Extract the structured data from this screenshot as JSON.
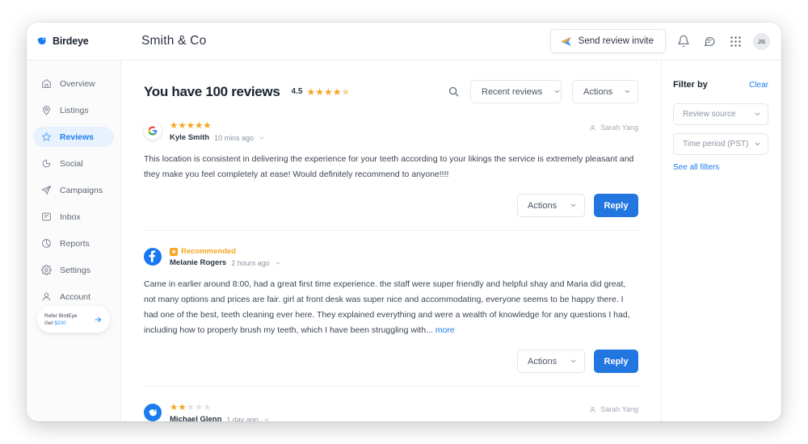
{
  "brand": {
    "name": "Birdeye",
    "logo_icon": "birdeye-logo-icon"
  },
  "header": {
    "business_title": "Smith & Co",
    "invite_button": "Send review invite",
    "invite_icon": "paper-plane-icon",
    "notifications_icon": "bell-icon",
    "messages_icon": "chat-bubble-icon",
    "apps_icon": "grid-apps-icon",
    "avatar_initials": "JS"
  },
  "sidebar": {
    "items": [
      {
        "label": "Overview",
        "icon": "home-icon",
        "active": false
      },
      {
        "label": "Listings",
        "icon": "location-pin-icon",
        "active": false
      },
      {
        "label": "Reviews",
        "icon": "star-icon",
        "active": true
      },
      {
        "label": "Social",
        "icon": "social-icon",
        "active": false
      },
      {
        "label": "Campaigns",
        "icon": "paper-plane-icon",
        "active": false
      },
      {
        "label": "Inbox",
        "icon": "inbox-message-icon",
        "active": false
      },
      {
        "label": "Reports",
        "icon": "pie-chart-icon",
        "active": false
      },
      {
        "label": "Settings",
        "icon": "gear-icon",
        "active": false
      },
      {
        "label": "Account",
        "icon": "person-icon",
        "active": false
      }
    ],
    "refer_card": {
      "line1": "Refer BirdEye",
      "line2_prefix": "Get ",
      "line2_amount": "$200",
      "arrow_icon": "arrow-right-icon"
    }
  },
  "main": {
    "page_title": "You have 100 reviews",
    "rating_value": "4.5",
    "rating_stars_filled": 4,
    "rating_stars_total": 5,
    "search_icon": "search-icon",
    "sort_select": "Recent reviews",
    "actions_select": "Actions",
    "reviews": [
      {
        "source": "google",
        "source_icon": "google-icon",
        "stars": 5,
        "recommended": null,
        "author": "Kyle Smith",
        "time": "10 mins ago",
        "assignee": "Sarah Yang",
        "assignee_icon": "person-icon",
        "text": "This location is consistent in delivering the experience for your teeth according to your likings the service is extremely pleasant and they make you feel completely at ease! Would definitely recommend to anyone!!!!",
        "more_label": null,
        "actions_label": "Actions",
        "reply_label": "Reply"
      },
      {
        "source": "facebook",
        "source_icon": "facebook-icon",
        "stars": 0,
        "recommended": "Recommended",
        "author": "Melanie Rogers",
        "time": "2 hours ago",
        "assignee": null,
        "assignee_icon": null,
        "text": "Came in earlier around 8:00, had a great first time experience. the staff were super friendly and helpful shay and Maria did great, not many options and prices are fair. girl at front desk was super nice and accommodating, everyone seems to be happy there. I had one of the best, teeth cleaning ever here. They explained everything and were a wealth of knowledge for any questions I had, including how to properly brush my teeth, which I have been struggling with...",
        "more_label": "more",
        "actions_label": "Actions",
        "reply_label": "Reply"
      },
      {
        "source": "birdeye",
        "source_icon": "birdeye-icon",
        "stars": 2,
        "recommended": null,
        "author": "Michael Glenn",
        "time": "1 day ago",
        "assignee": "Sarah Yang",
        "assignee_icon": "person-icon",
        "text": null,
        "more_label": null,
        "actions_label": null,
        "reply_label": null
      }
    ]
  },
  "filters": {
    "title": "Filter by",
    "clear_label": "Clear",
    "review_source": "Review source",
    "time_period": "Time period (PST)",
    "see_all": "See all filters"
  },
  "colors": {
    "accent_blue": "#2176e0",
    "link_blue": "#1b7ced",
    "star_orange": "#f5a623",
    "facebook_blue": "#1877f2"
  }
}
